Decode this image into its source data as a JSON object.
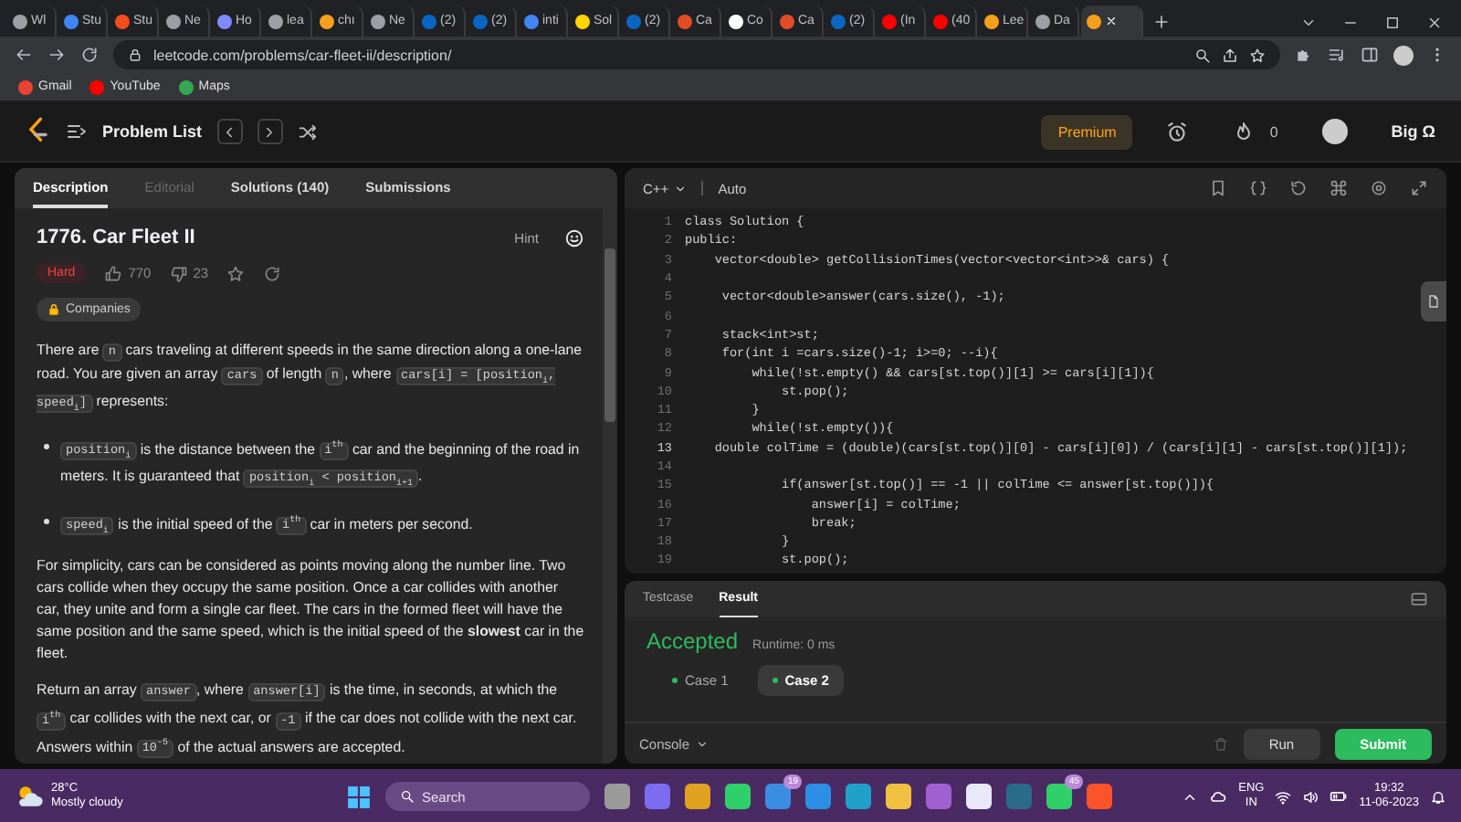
{
  "browser": {
    "tabs": [
      {
        "title": "Wl",
        "color": "#9aa0a6",
        "selected": false
      },
      {
        "title": "Stu",
        "color": "#4285f4",
        "selected": false
      },
      {
        "title": "Stu",
        "color": "#f24e1e",
        "selected": false
      },
      {
        "title": "Ne",
        "color": "#9aa0a6",
        "selected": false
      },
      {
        "title": "Ho",
        "color": "#7c8cff",
        "selected": false
      },
      {
        "title": "lea",
        "color": "#9aa0a6",
        "selected": false
      },
      {
        "title": "chı",
        "color": "#f89f1b",
        "selected": false
      },
      {
        "title": "Ne",
        "color": "#9aa0a6",
        "selected": false
      },
      {
        "title": "(2)",
        "color": "#0a66c2",
        "selected": false
      },
      {
        "title": "(2)",
        "color": "#0a66c2",
        "selected": false
      },
      {
        "title": "inti",
        "color": "#4285f4",
        "selected": false
      },
      {
        "title": "Sol",
        "color": "#ffd400",
        "selected": false
      },
      {
        "title": "(2)",
        "color": "#0a66c2",
        "selected": false
      },
      {
        "title": "Ca",
        "color": "#e34c26",
        "selected": false
      },
      {
        "title": "Co",
        "color": "#ffffff",
        "selected": false
      },
      {
        "title": "Ca",
        "color": "#e34c26",
        "selected": false
      },
      {
        "title": "(2)",
        "color": "#0a66c2",
        "selected": false
      },
      {
        "title": "(In",
        "color": "#ff0000",
        "selected": false
      },
      {
        "title": "(40",
        "color": "#ff0000",
        "selected": false
      },
      {
        "title": "Lee",
        "color": "#f89f1b",
        "selected": false
      },
      {
        "title": "Da",
        "color": "#9aa0a6",
        "selected": false
      },
      {
        "color": "#f89f1b",
        "selected": true
      }
    ],
    "url": "leetcode.com/problems/car-fleet-ii/description/",
    "bookmarks": [
      "Gmail",
      "YouTube",
      "Maps"
    ]
  },
  "header": {
    "problem_list": "Problem List",
    "premium": "Premium",
    "streak": "0",
    "user": "Big Ω"
  },
  "left_tabs": [
    {
      "label": "Description",
      "selected": true,
      "disabled": false
    },
    {
      "label": "Editorial",
      "selected": false,
      "disabled": true
    },
    {
      "label": "Solutions (140)",
      "selected": false,
      "disabled": false
    },
    {
      "label": "Submissions",
      "selected": false,
      "disabled": false
    }
  ],
  "problem": {
    "title": "1776. Car Fleet II",
    "hint": "Hint",
    "difficulty": "Hard",
    "likes": "770",
    "dislikes": "23",
    "companies": "Companies",
    "description": [
      {
        "kind": "paragraph",
        "parts": [
          {
            "kind": "text",
            "text": "There are "
          },
          {
            "kind": "code",
            "text": "n"
          },
          {
            "kind": "text",
            "text": " cars traveling at different speeds in the same direction along a one-lane road. You are given an array "
          },
          {
            "kind": "code",
            "text": "cars"
          },
          {
            "kind": "text",
            "text": " of length "
          },
          {
            "kind": "code",
            "text": "n"
          },
          {
            "kind": "text",
            "text": ", where "
          },
          {
            "kind": "code",
            "text": "cars[i] = [position$_{i}$, speed$_{i}$]"
          },
          {
            "kind": "text",
            "text": " represents:"
          }
        ]
      },
      {
        "kind": "bullet",
        "parts": [
          {
            "kind": "code",
            "text": "position$_{i}$"
          },
          {
            "kind": "text",
            "text": " is the distance between the "
          },
          {
            "kind": "code",
            "text": "i$^{th}$"
          },
          {
            "kind": "text",
            "text": " car and the beginning of the road in meters. It is guaranteed that "
          },
          {
            "kind": "code",
            "text": "position$_{i}$ < position$_{i+1}$"
          },
          {
            "kind": "text",
            "text": "."
          }
        ]
      },
      {
        "kind": "bullet",
        "parts": [
          {
            "kind": "code",
            "text": "speed$_{i}$"
          },
          {
            "kind": "text",
            "text": " is the initial speed of the "
          },
          {
            "kind": "code",
            "text": "i$^{th}$"
          },
          {
            "kind": "text",
            "text": " car in meters per second."
          }
        ]
      },
      {
        "kind": "paragraph",
        "parts": [
          {
            "kind": "text",
            "text": "For simplicity, cars can be considered as points moving along the number line. Two cars collide when they occupy the same position. Once a car collides with another car, they unite and form a single car fleet. The cars in the formed fleet will have the same position and the same speed, which is the initial speed of the **slowest** car in the fleet."
          }
        ]
      },
      {
        "kind": "paragraph",
        "parts": [
          {
            "kind": "text",
            "text": "Return an array "
          },
          {
            "kind": "code",
            "text": "answer"
          },
          {
            "kind": "text",
            "text": ", where "
          },
          {
            "kind": "code",
            "text": "answer[i]"
          },
          {
            "kind": "text",
            "text": " is the time, in seconds, at which the "
          },
          {
            "kind": "code",
            "text": "i$^{th}$"
          },
          {
            "kind": "text",
            "text": " car collides with the next car, or "
          },
          {
            "kind": "code",
            "text": "-1"
          },
          {
            "kind": "text",
            "text": " if the car does not collide with the next car. Answers within "
          },
          {
            "kind": "code",
            "text": "10$^{-5}$"
          },
          {
            "kind": "text",
            "text": " of the actual answers are accepted."
          }
        ]
      }
    ]
  },
  "editor": {
    "language": "C++",
    "mode": "Auto",
    "lines": [
      {
        "number": "1",
        "text": "class Solution {",
        "current": false
      },
      {
        "number": "2",
        "text": "public:",
        "current": false
      },
      {
        "number": "3",
        "text": "    vector<double> getCollisionTimes(vector<vector<int>>& cars) {",
        "current": false
      },
      {
        "number": "4",
        "current": false
      },
      {
        "number": "5",
        "text": "     vector<double>answer(cars.size(), -1);",
        "current": false
      },
      {
        "number": "6",
        "current": false
      },
      {
        "number": "7",
        "text": "     stack<int>st;",
        "current": false
      },
      {
        "number": "8",
        "text": "     for(int i =cars.size()-1; i>=0; --i){",
        "current": false
      },
      {
        "number": "9",
        "text": "         while(!st.empty() && cars[st.top()][1] >= cars[i][1]){",
        "current": false
      },
      {
        "number": "10",
        "text": "             st.pop();",
        "current": false
      },
      {
        "number": "11",
        "text": "         }",
        "current": false
      },
      {
        "number": "12",
        "text": "         while(!st.empty()){",
        "current": false
      },
      {
        "number": "13",
        "text": "    double colTime = (double)(cars[st.top()][0] - cars[i][0]) / (cars[i][1] - cars[st.top()][1]);",
        "current": true
      },
      {
        "number": "14",
        "current": false
      },
      {
        "number": "15",
        "text": "             if(answer[st.top()] == -1 || colTime <= answer[st.top()]){",
        "current": false
      },
      {
        "number": "16",
        "text": "                 answer[i] = colTime;",
        "current": false
      },
      {
        "number": "17",
        "text": "                 break;",
        "current": false
      },
      {
        "number": "18",
        "text": "             }",
        "current": false
      },
      {
        "number": "19",
        "text": "             st.pop();",
        "current": false
      }
    ]
  },
  "result": {
    "tabs": [
      {
        "label": "Testcase",
        "selected": false
      },
      {
        "label": "Result",
        "selected": true
      }
    ],
    "status": "Accepted",
    "runtime": "Runtime: 0 ms",
    "cases": [
      {
        "label": "Case 1",
        "selected": false
      },
      {
        "label": "Case 2",
        "selected": true
      }
    ],
    "console": "Console",
    "run": "Run",
    "submit": "Submit"
  },
  "taskbar": {
    "temperature": "28°C",
    "weather": "Mostly cloudy",
    "search_placeholder": "Search",
    "mail_badge": "19",
    "chat_badge": "45",
    "language": "ENG",
    "region": "IN",
    "time": "19:32",
    "date": "11-06-2023"
  }
}
